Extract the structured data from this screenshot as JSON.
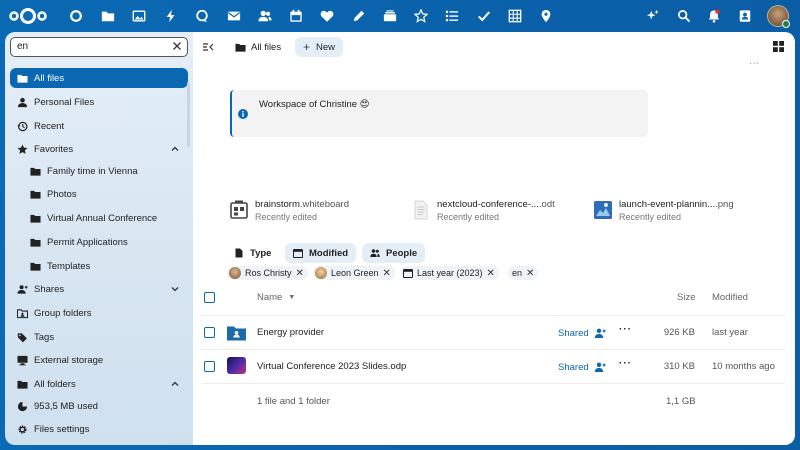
{
  "colors": {
    "header_bg": "#0b66b0",
    "accent": "#0a67b2",
    "sidebar_bg": "#dce8f3"
  },
  "topbar": {
    "logo": "nextcloud-logo",
    "apps": [
      "dashboard-icon",
      "files-icon",
      "photos-icon",
      "activity-icon",
      "talk-icon",
      "mail-icon",
      "contacts-icon",
      "calendar-icon",
      "favorites-icon",
      "notes-icon",
      "deck-icon",
      "star-icon",
      "tasks-icon",
      "checkmark-icon",
      "tables-icon",
      "maps-icon"
    ],
    "right": [
      "assistant-icon",
      "search-icon",
      "notifications-icon",
      "contacts-menu-icon",
      "user-avatar"
    ]
  },
  "sidebar": {
    "search": {
      "value": "en"
    },
    "items": [
      {
        "label": "All files",
        "icon": "folder-icon",
        "active": true
      },
      {
        "label": "Personal Files",
        "icon": "person-icon"
      },
      {
        "label": "Recent",
        "icon": "history-icon"
      },
      {
        "label": "Favorites",
        "icon": "star-icon",
        "expanded": true
      },
      {
        "label": "Family time in Vienna",
        "icon": "folder-icon",
        "sub": true
      },
      {
        "label": "Photos",
        "icon": "folder-icon",
        "sub": true
      },
      {
        "label": "Virtual Annual Conference",
        "icon": "folder-icon",
        "sub": true
      },
      {
        "label": "Permit Applications",
        "icon": "folder-icon",
        "sub": true
      },
      {
        "label": "Templates",
        "icon": "folder-icon",
        "sub": true
      },
      {
        "label": "Shares",
        "icon": "share-icon",
        "expanded": false
      },
      {
        "label": "Group folders",
        "icon": "group-folder-icon"
      },
      {
        "label": "Tags",
        "icon": "tag-icon"
      },
      {
        "label": "External storage",
        "icon": "monitor-icon"
      },
      {
        "label": "All folders",
        "icon": "folder-icon",
        "expanded": true
      },
      {
        "label": "953,5 MB used",
        "icon": "pie-icon"
      },
      {
        "label": "Files settings",
        "icon": "gear-icon"
      }
    ]
  },
  "main": {
    "breadcrumb": "All files",
    "new_label": "New",
    "description": "Workspace of Christine 😍",
    "recent": [
      {
        "name": "brainstorm",
        "ext": ".whiteboard",
        "sub": "Recently edited",
        "icon": "whiteboard-icon"
      },
      {
        "name": "nextcloud-conference-...",
        "ext": ".odt",
        "sub": "Recently edited",
        "icon": "document-icon"
      },
      {
        "name": "launch-event-plannin...",
        "ext": ".png",
        "sub": "Recently edited",
        "icon": "image-icon"
      }
    ],
    "filters": {
      "type": "Type",
      "modified": "Modified",
      "people": "People"
    },
    "chips": [
      {
        "label": "Ros Christy",
        "kind": "person"
      },
      {
        "label": "Leon Green",
        "kind": "person"
      },
      {
        "label": "Last year (2023)",
        "kind": "date"
      },
      {
        "label": "en",
        "kind": "text"
      }
    ],
    "table": {
      "headers": {
        "name": "Name",
        "size": "Size",
        "modified": "Modified"
      },
      "rows": [
        {
          "name": "Energy provider",
          "shared": "Shared",
          "size": "926 KB",
          "modified": "last year",
          "kind": "folder"
        },
        {
          "name": "Virtual Conference 2023 Slides.odp",
          "shared": "Shared",
          "size": "310 KB",
          "modified": "10 months ago",
          "kind": "presentation"
        }
      ],
      "summary": {
        "count": "1 file and 1 folder",
        "size": "1,1 GB"
      }
    }
  }
}
